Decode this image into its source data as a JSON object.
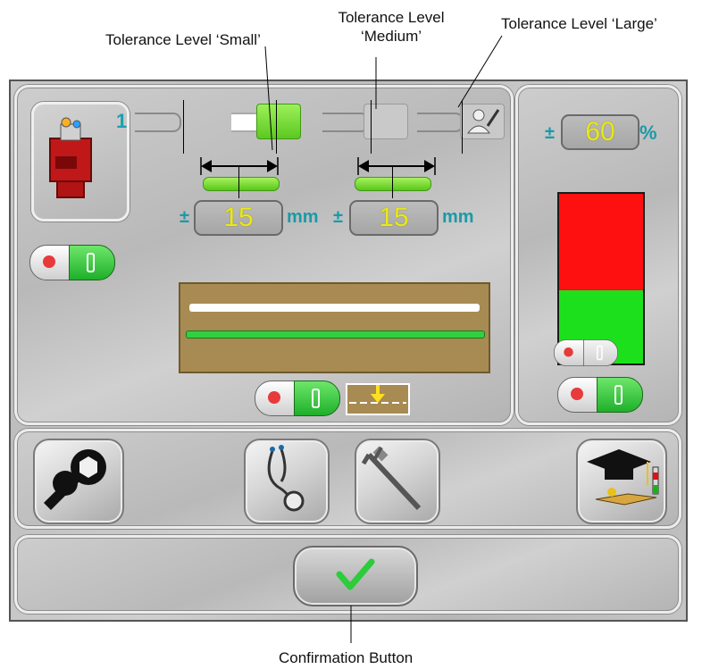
{
  "callouts": {
    "small": "Tolerance Level ‘Small’",
    "medium_line1": "Tolerance Level",
    "medium_line2": "‘Medium’",
    "large": "Tolerance Level ‘Large’",
    "confirm": "Confirmation Button"
  },
  "sensor": {
    "channel": "1",
    "icon": "sensor-device-icon"
  },
  "tolerance_levels": [
    {
      "name": "small",
      "active": true
    },
    {
      "name": "medium",
      "active": false
    },
    {
      "name": "large",
      "active": false,
      "icon": "user-edit-icon"
    }
  ],
  "tolerances": {
    "plus_minus": "±",
    "left_value": "15",
    "left_unit": "mm",
    "right_value": "15",
    "right_unit": "mm"
  },
  "percent": {
    "plus_minus": "±",
    "value": "60",
    "unit": "%"
  },
  "level_meter": {
    "red_fraction": 0.57,
    "green_fraction": 0.43
  },
  "tools": [
    {
      "name": "wrench",
      "icon": "wrench-icon"
    },
    {
      "name": "diagnostics",
      "icon": "stethoscope-icon"
    },
    {
      "name": "calibration",
      "icon": "caliper-icon"
    },
    {
      "name": "teach",
      "icon": "graduation-cap-icon"
    }
  ],
  "colors": {
    "active_green": "#5cc820",
    "value_yellow": "#e9e81a",
    "accent_teal": "#1a9aa8",
    "meter_red": "#ff1010",
    "meter_green": "#1de01d",
    "scan_brown": "#a88b52"
  }
}
